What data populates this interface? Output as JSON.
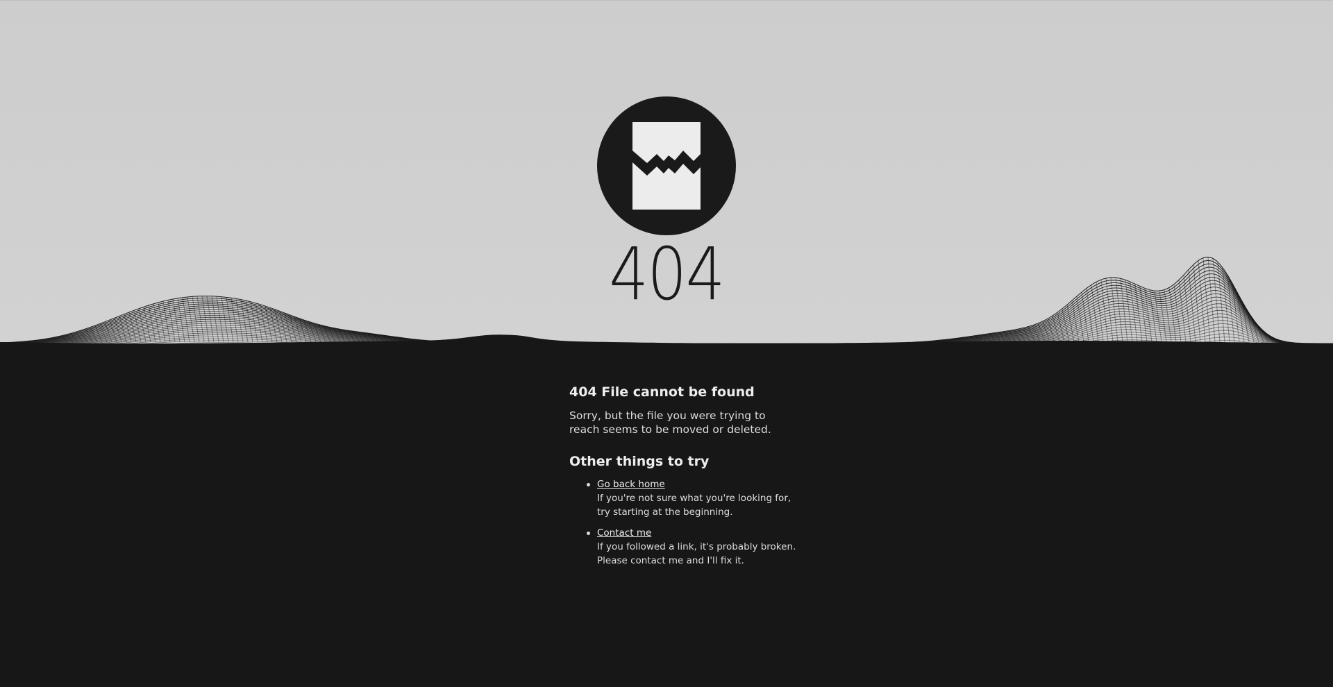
{
  "hero": {
    "code": "404",
    "logo_icon": "broken-page-icon"
  },
  "main": {
    "title": "404 File cannot be found",
    "description": "Sorry, but the file you were trying to reach seems to be moved or deleted.",
    "subtitle": "Other things to try",
    "options": [
      {
        "link": "Go back home",
        "line1": "If you're not sure what you're looking for,",
        "line2": "try starting at the beginning."
      },
      {
        "link": "Contact me",
        "line1": "If you followed a link, it's probably broken.",
        "line2": "Please contact me and I'll fix it."
      }
    ]
  },
  "colors": {
    "top_background": "#d0d0d0",
    "bottom_background": "#171717",
    "ink": "#1a1a1a",
    "text_light": "#e7e7e7"
  }
}
